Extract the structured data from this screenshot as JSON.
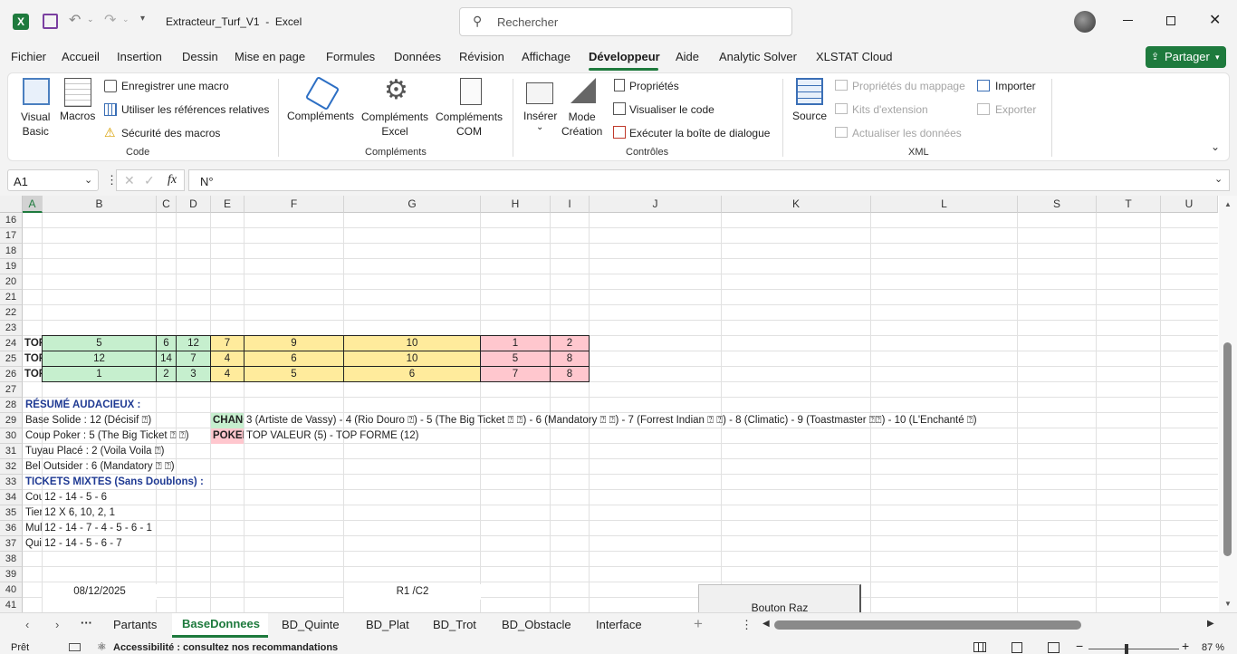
{
  "app": {
    "title": "Extracteur_Turf_V1  -  Excel",
    "search_placeholder": "Rechercher",
    "share_label": "Partager"
  },
  "menu": [
    "Fichier",
    "Accueil",
    "Insertion",
    "Dessin",
    "Mise en page",
    "Formules",
    "Données",
    "Révision",
    "Affichage",
    "Développeur",
    "Aide",
    "Analytic Solver",
    "XLSTAT Cloud"
  ],
  "menu_active": "Développeur",
  "ribbon": {
    "visual_basic": "Visual\nBasic",
    "macros": "Macros",
    "record_macro": "Enregistrer une macro",
    "relative_refs": "Utiliser les références relatives",
    "macro_security": "Sécurité des macros",
    "group_code": "Code",
    "complements": "Compléments",
    "complements_excel": "Compléments\nExcel",
    "complements_com": "Compléments\nCOM",
    "group_complements": "Compléments",
    "inserer": "Insérer",
    "mode_creation": "Mode\nCréation",
    "proprietes": "Propriétés",
    "visualiser_code": "Visualiser le code",
    "executer_boite": "Exécuter la boîte de dialogue",
    "group_controles": "Contrôles",
    "source": "Source",
    "map_props": "Propriétés du mappage",
    "kits": "Kits d'extension",
    "actualiser": "Actualiser les données",
    "importer": "Importer",
    "exporter": "Exporter",
    "group_xml": "XML"
  },
  "formula": {
    "name_box": "A1",
    "fx": "fx",
    "content": "N°"
  },
  "columns": [
    "A",
    "B",
    "C",
    "D",
    "E",
    "F",
    "G",
    "H",
    "I",
    "J",
    "K",
    "L",
    "S",
    "T",
    "U"
  ],
  "rows": [
    "16",
    "17",
    "18",
    "19",
    "20",
    "21",
    "22",
    "23",
    "24",
    "25",
    "26",
    "27",
    "28",
    "29",
    "30",
    "31",
    "32",
    "33",
    "34",
    "35",
    "36",
    "37",
    "38",
    "39",
    "40",
    "41"
  ],
  "table": {
    "row24": {
      "a": "TOP",
      "b": "5",
      "c": "6",
      "d": "12",
      "e": "7",
      "f": "9",
      "g": "10",
      "h": "1",
      "i": "2"
    },
    "row25": {
      "a": "TOP",
      "b": "12",
      "c": "14",
      "d": "7",
      "e": "4",
      "f": "6",
      "g": "10",
      "h": "5",
      "i": "8"
    },
    "row26": {
      "a": "TOP",
      "b": "1",
      "c": "2",
      "d": "3",
      "e": "4",
      "f": "5",
      "g": "6",
      "h": "7",
      "i": "8"
    }
  },
  "text": {
    "resume": "RÉSUMÉ AUDACIEUX :",
    "base_solide": "Base Solide : 12 (Décisif    ⍰)",
    "chance_label": "CHANCES",
    "chance_text": "3 (Artiste de Vassy) - 4 (Rio Douro    ⍰) - 5 (The Big Ticket ⍰ ⍰) - 6 (Mandatory ⍰ ⍰) - 7 (Forrest Indian ⍰ ⍰) - 8 (Climatic) - 9 (Toastmaster    ⍰⍰) - 10 (L'Enchanté ⍰)",
    "coup_poker": "Coup Poker : 5 (The Big Ticket ⍰ ⍰)",
    "poker_label": "POKER",
    "poker_text": "TOP VALEUR (5) - TOP FORME (12)",
    "tuyau": "Tuyau Placé : 2 (Voila Voila     ⍰)",
    "bel_outsider": "Bel Outsider : 6 (Mandatory ⍰ ⍰)",
    "tickets": "TICKETS MIXTES (Sans Doublons) :",
    "r34a": "Couplé",
    "r34b": "12 - 14 - 5 - 6",
    "r35a": "Tiercé",
    "r35b": "12 X 6, 10, 2, 1",
    "r36a": "Multi",
    "r36b": "12 - 14 - 7 - 4 - 5 - 6 - 1",
    "r37a": "Quinté",
    "r37b": "12 - 14 - 5 - 6 - 7",
    "date": "08/12/2025",
    "race": "R1 /C2",
    "button": "Bouton Raz"
  },
  "tabs": [
    "Partants",
    "BaseDonnees",
    "BD_Quinte",
    "BD_Plat",
    "BD_Trot",
    "BD_Obstacle",
    "Interface"
  ],
  "active_tab": "BaseDonnees",
  "status": {
    "ready": "Prêt",
    "accessibility": "Accessibilité : consultez nos recommandations",
    "zoom": "87 %"
  },
  "colors": {
    "green": "#c6efce",
    "yellow": "#ffeb9c",
    "pink": "#ffc7ce",
    "excel_green": "#217346",
    "share_green": "#1e7a3d",
    "accent": "#1f3a93"
  }
}
